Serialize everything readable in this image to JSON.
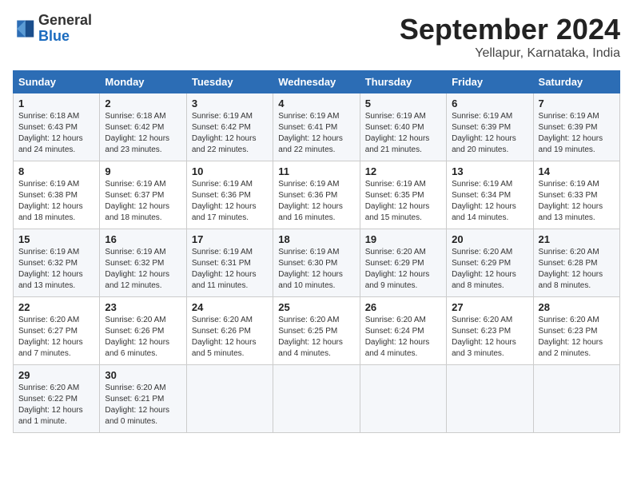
{
  "header": {
    "logo_line1": "General",
    "logo_line2": "Blue",
    "month_year": "September 2024",
    "location": "Yellapur, Karnataka, India"
  },
  "days_of_week": [
    "Sunday",
    "Monday",
    "Tuesday",
    "Wednesday",
    "Thursday",
    "Friday",
    "Saturday"
  ],
  "weeks": [
    [
      {
        "day": "1",
        "info": "Sunrise: 6:18 AM\nSunset: 6:43 PM\nDaylight: 12 hours\nand 24 minutes."
      },
      {
        "day": "2",
        "info": "Sunrise: 6:18 AM\nSunset: 6:42 PM\nDaylight: 12 hours\nand 23 minutes."
      },
      {
        "day": "3",
        "info": "Sunrise: 6:19 AM\nSunset: 6:42 PM\nDaylight: 12 hours\nand 22 minutes."
      },
      {
        "day": "4",
        "info": "Sunrise: 6:19 AM\nSunset: 6:41 PM\nDaylight: 12 hours\nand 22 minutes."
      },
      {
        "day": "5",
        "info": "Sunrise: 6:19 AM\nSunset: 6:40 PM\nDaylight: 12 hours\nand 21 minutes."
      },
      {
        "day": "6",
        "info": "Sunrise: 6:19 AM\nSunset: 6:39 PM\nDaylight: 12 hours\nand 20 minutes."
      },
      {
        "day": "7",
        "info": "Sunrise: 6:19 AM\nSunset: 6:39 PM\nDaylight: 12 hours\nand 19 minutes."
      }
    ],
    [
      {
        "day": "8",
        "info": "Sunrise: 6:19 AM\nSunset: 6:38 PM\nDaylight: 12 hours\nand 18 minutes."
      },
      {
        "day": "9",
        "info": "Sunrise: 6:19 AM\nSunset: 6:37 PM\nDaylight: 12 hours\nand 18 minutes."
      },
      {
        "day": "10",
        "info": "Sunrise: 6:19 AM\nSunset: 6:36 PM\nDaylight: 12 hours\nand 17 minutes."
      },
      {
        "day": "11",
        "info": "Sunrise: 6:19 AM\nSunset: 6:36 PM\nDaylight: 12 hours\nand 16 minutes."
      },
      {
        "day": "12",
        "info": "Sunrise: 6:19 AM\nSunset: 6:35 PM\nDaylight: 12 hours\nand 15 minutes."
      },
      {
        "day": "13",
        "info": "Sunrise: 6:19 AM\nSunset: 6:34 PM\nDaylight: 12 hours\nand 14 minutes."
      },
      {
        "day": "14",
        "info": "Sunrise: 6:19 AM\nSunset: 6:33 PM\nDaylight: 12 hours\nand 13 minutes."
      }
    ],
    [
      {
        "day": "15",
        "info": "Sunrise: 6:19 AM\nSunset: 6:32 PM\nDaylight: 12 hours\nand 13 minutes."
      },
      {
        "day": "16",
        "info": "Sunrise: 6:19 AM\nSunset: 6:32 PM\nDaylight: 12 hours\nand 12 minutes."
      },
      {
        "day": "17",
        "info": "Sunrise: 6:19 AM\nSunset: 6:31 PM\nDaylight: 12 hours\nand 11 minutes."
      },
      {
        "day": "18",
        "info": "Sunrise: 6:19 AM\nSunset: 6:30 PM\nDaylight: 12 hours\nand 10 minutes."
      },
      {
        "day": "19",
        "info": "Sunrise: 6:20 AM\nSunset: 6:29 PM\nDaylight: 12 hours\nand 9 minutes."
      },
      {
        "day": "20",
        "info": "Sunrise: 6:20 AM\nSunset: 6:29 PM\nDaylight: 12 hours\nand 8 minutes."
      },
      {
        "day": "21",
        "info": "Sunrise: 6:20 AM\nSunset: 6:28 PM\nDaylight: 12 hours\nand 8 minutes."
      }
    ],
    [
      {
        "day": "22",
        "info": "Sunrise: 6:20 AM\nSunset: 6:27 PM\nDaylight: 12 hours\nand 7 minutes."
      },
      {
        "day": "23",
        "info": "Sunrise: 6:20 AM\nSunset: 6:26 PM\nDaylight: 12 hours\nand 6 minutes."
      },
      {
        "day": "24",
        "info": "Sunrise: 6:20 AM\nSunset: 6:26 PM\nDaylight: 12 hours\nand 5 minutes."
      },
      {
        "day": "25",
        "info": "Sunrise: 6:20 AM\nSunset: 6:25 PM\nDaylight: 12 hours\nand 4 minutes."
      },
      {
        "day": "26",
        "info": "Sunrise: 6:20 AM\nSunset: 6:24 PM\nDaylight: 12 hours\nand 4 minutes."
      },
      {
        "day": "27",
        "info": "Sunrise: 6:20 AM\nSunset: 6:23 PM\nDaylight: 12 hours\nand 3 minutes."
      },
      {
        "day": "28",
        "info": "Sunrise: 6:20 AM\nSunset: 6:23 PM\nDaylight: 12 hours\nand 2 minutes."
      }
    ],
    [
      {
        "day": "29",
        "info": "Sunrise: 6:20 AM\nSunset: 6:22 PM\nDaylight: 12 hours\nand 1 minute."
      },
      {
        "day": "30",
        "info": "Sunrise: 6:20 AM\nSunset: 6:21 PM\nDaylight: 12 hours\nand 0 minutes."
      },
      {
        "day": "",
        "info": ""
      },
      {
        "day": "",
        "info": ""
      },
      {
        "day": "",
        "info": ""
      },
      {
        "day": "",
        "info": ""
      },
      {
        "day": "",
        "info": ""
      }
    ]
  ]
}
